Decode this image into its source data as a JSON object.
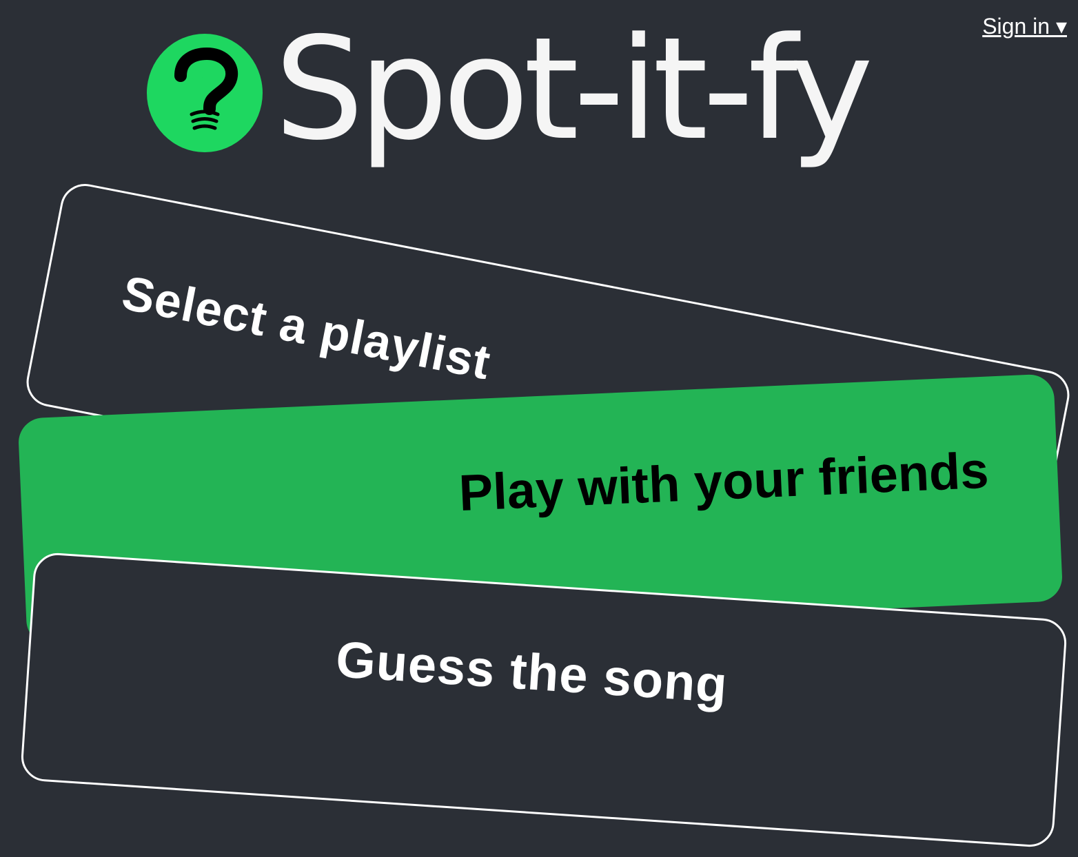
{
  "header": {
    "signin_label": "Sign in ▾",
    "brand": {
      "name": "Spot-it-fy",
      "icon": "question-mark-speaker-icon",
      "icon_bg_color": "#1ed760",
      "text_color": "#f5f5f5"
    }
  },
  "menu": {
    "items": [
      {
        "label": "Select a playlist"
      },
      {
        "label": "Play with your friends"
      },
      {
        "label": "Guess the song"
      }
    ]
  },
  "colors": {
    "background": "#2b2f36",
    "accent": "#23b455",
    "outline": "#ffffff"
  }
}
